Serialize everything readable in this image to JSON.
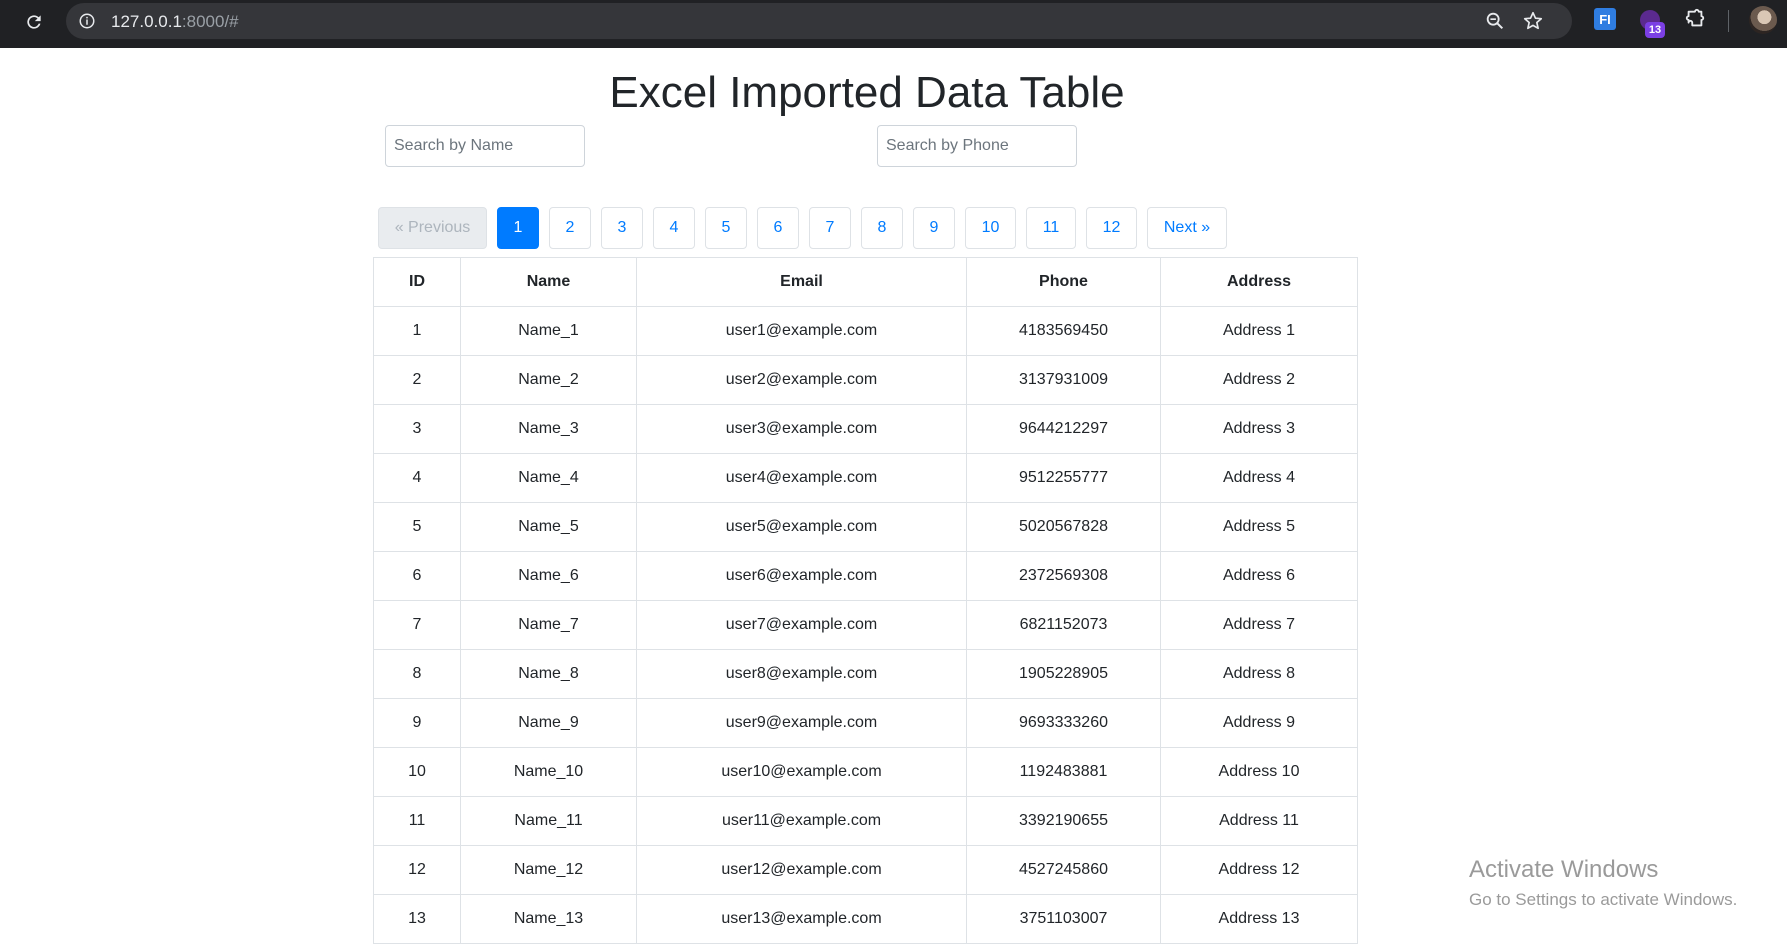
{
  "browser": {
    "url_host": "127.0.0.1",
    "url_rest": ":8000/#",
    "extension_badge": "13",
    "extension_fi": "FI"
  },
  "page": {
    "title": "Excel Imported Data Table",
    "search_name_placeholder": "Search by Name",
    "search_phone_placeholder": "Search by Phone"
  },
  "pagination": {
    "previous": "« Previous",
    "next": "Next »",
    "pages": [
      "1",
      "2",
      "3",
      "4",
      "5",
      "6",
      "7",
      "8",
      "9",
      "10",
      "11",
      "12"
    ],
    "active": "1"
  },
  "table": {
    "headers": [
      "ID",
      "Name",
      "Email",
      "Phone",
      "Address"
    ],
    "rows": [
      [
        "1",
        "Name_1",
        "user1@example.com",
        "4183569450",
        "Address 1"
      ],
      [
        "2",
        "Name_2",
        "user2@example.com",
        "3137931009",
        "Address 2"
      ],
      [
        "3",
        "Name_3",
        "user3@example.com",
        "9644212297",
        "Address 3"
      ],
      [
        "4",
        "Name_4",
        "user4@example.com",
        "9512255777",
        "Address 4"
      ],
      [
        "5",
        "Name_5",
        "user5@example.com",
        "5020567828",
        "Address 5"
      ],
      [
        "6",
        "Name_6",
        "user6@example.com",
        "2372569308",
        "Address 6"
      ],
      [
        "7",
        "Name_7",
        "user7@example.com",
        "6821152073",
        "Address 7"
      ],
      [
        "8",
        "Name_8",
        "user8@example.com",
        "1905228905",
        "Address 8"
      ],
      [
        "9",
        "Name_9",
        "user9@example.com",
        "9693333260",
        "Address 9"
      ],
      [
        "10",
        "Name_10",
        "user10@example.com",
        "1192483881",
        "Address 10"
      ],
      [
        "11",
        "Name_11",
        "user11@example.com",
        "3392190655",
        "Address 11"
      ],
      [
        "12",
        "Name_12",
        "user12@example.com",
        "4527245860",
        "Address 12"
      ],
      [
        "13",
        "Name_13",
        "user13@example.com",
        "3751103007",
        "Address 13"
      ]
    ]
  },
  "watermark": {
    "title": "Activate Windows",
    "subtitle": "Go to Settings to activate Windows."
  },
  "colors": {
    "primary": "#007bff",
    "chrome_bg": "#202124",
    "omnibox_bg": "#35363a"
  }
}
